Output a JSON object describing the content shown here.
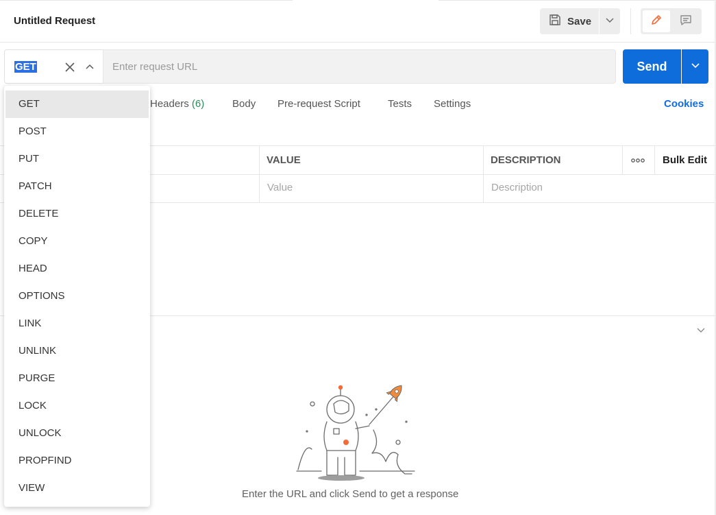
{
  "header": {
    "title": "Untitled Request",
    "save_label": "Save"
  },
  "request": {
    "method": "GET",
    "url_placeholder": "Enter request URL",
    "url_value": "",
    "send_label": "Send"
  },
  "tabs": [
    {
      "label": "Headers",
      "count": "(6)"
    },
    {
      "label": "Body"
    },
    {
      "label": "Pre-request Script"
    },
    {
      "label": "Tests"
    },
    {
      "label": "Settings"
    }
  ],
  "cookies_label": "Cookies",
  "table": {
    "columns": [
      "VALUE",
      "DESCRIPTION"
    ],
    "bulk_edit_label": "Bulk Edit",
    "row_placeholders": {
      "value": "Value",
      "description": "Description"
    }
  },
  "response": {
    "message": "Enter the URL and click Send to get a response"
  },
  "method_menu": {
    "options": [
      "GET",
      "POST",
      "PUT",
      "PATCH",
      "DELETE",
      "COPY",
      "HEAD",
      "OPTIONS",
      "LINK",
      "UNLINK",
      "PURGE",
      "LOCK",
      "UNLOCK",
      "PROPFIND",
      "VIEW"
    ],
    "selected": "GET"
  },
  "colors": {
    "accent": "#0f6ddb",
    "edit_icon": "#f26b3a",
    "count": "#2a8a5a"
  },
  "icons": {
    "save": "save-icon",
    "caret": "chevron-down-icon",
    "edit": "pencil-icon",
    "comment": "comment-icon",
    "clear": "close-icon",
    "toggle": "chevron-up-icon",
    "more": "more-icon"
  }
}
